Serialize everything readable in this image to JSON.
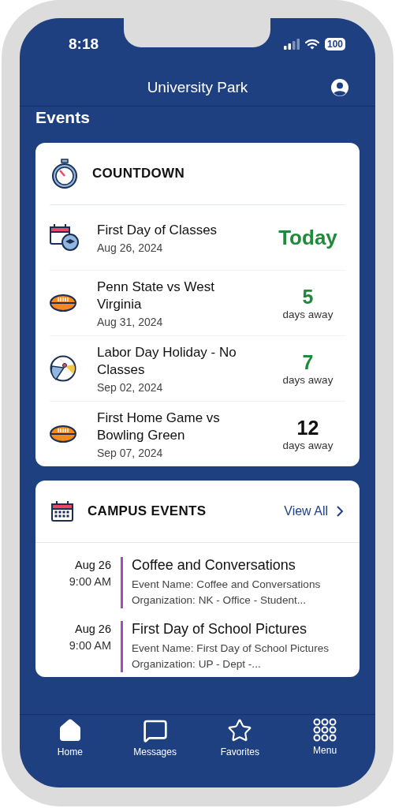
{
  "status_bar": {
    "time": "8:18",
    "battery": "100"
  },
  "header": {
    "title": "University Park"
  },
  "page_title": "Events",
  "countdown": {
    "title": "COUNTDOWN",
    "items": [
      {
        "kind": "calendar",
        "title": "First Day of Classes",
        "date": "Aug 26, 2024",
        "count": "Today",
        "color": "#1e8a3a"
      },
      {
        "kind": "football",
        "title": "Penn State vs West Virginia",
        "date": "Aug 31, 2024",
        "count": "5",
        "unit": "days away",
        "color": "#1e8a3a"
      },
      {
        "kind": "beachball",
        "title": "Labor Day Holiday - No Classes",
        "date": "Sep 02, 2024",
        "count": "7",
        "unit": "days away",
        "color": "#1e8a3a"
      },
      {
        "kind": "football",
        "title": "First Home Game vs Bowling Green",
        "date": "Sep 07, 2024",
        "count": "12",
        "unit": "days away",
        "color": "#111111"
      }
    ]
  },
  "campus_events": {
    "title": "CAMPUS EVENTS",
    "link": "View All",
    "items": [
      {
        "date": "Aug 26",
        "time": "9:00 AM",
        "title": "Coffee and Conversations",
        "description": "Event Name: Coffee and Conversations Organization: NK - Office - Student...",
        "color": "#a04fb5"
      },
      {
        "date": "Aug 26",
        "time": "9:00 AM",
        "title": "First Day of School Pictures",
        "description": "Event Name: First Day of School Pictures Organization: UP - Dept -...",
        "color": "#a04fb5"
      }
    ]
  },
  "tab_bar": [
    {
      "kind": "home",
      "label": "Home"
    },
    {
      "kind": "messages",
      "label": "Messages"
    },
    {
      "kind": "favorites",
      "label": "Favorites"
    },
    {
      "kind": "menu",
      "label": "Menu"
    }
  ]
}
